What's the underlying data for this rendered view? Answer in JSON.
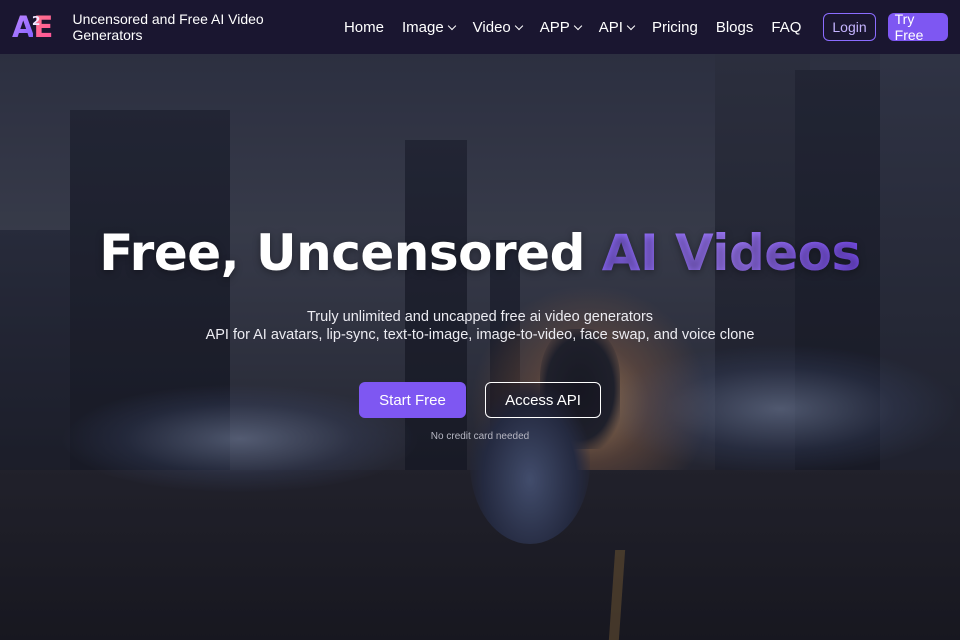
{
  "brand": {
    "logo_a": "A",
    "logo_sup": "2",
    "logo_e": "E",
    "tagline": "Uncensored and Free AI Video Generators"
  },
  "nav": {
    "items": [
      {
        "label": "Home",
        "dropdown": false
      },
      {
        "label": "Image",
        "dropdown": true
      },
      {
        "label": "Video",
        "dropdown": true
      },
      {
        "label": "APP",
        "dropdown": true
      },
      {
        "label": "API",
        "dropdown": true
      },
      {
        "label": "Pricing",
        "dropdown": false
      },
      {
        "label": "Blogs",
        "dropdown": false
      },
      {
        "label": "FAQ",
        "dropdown": false
      }
    ],
    "login_label": "Login",
    "try_label": "Try Free"
  },
  "hero": {
    "headline_main": "Free, Uncensored ",
    "headline_accent": "AI Videos",
    "sub1": "Truly unlimited and uncapped free ai video generators",
    "sub2": "API for AI avatars, lip-sync, text-to-image, image-to-video, face swap, and voice clone",
    "start_label": "Start Free",
    "api_label": "Access API",
    "note": "No credit card needed"
  },
  "colors": {
    "accent": "#7e57f2",
    "nav_bg": "#1a1630"
  }
}
